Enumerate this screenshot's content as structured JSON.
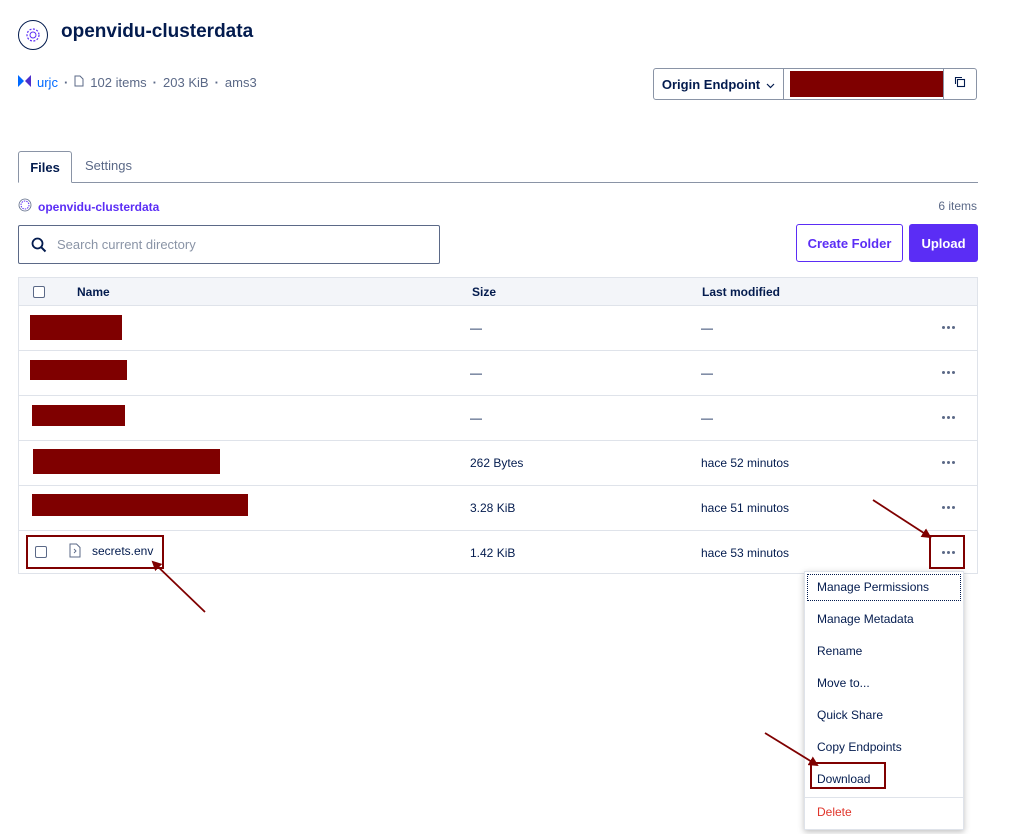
{
  "header": {
    "title": "openvidu-clusterdata",
    "project": "urjc",
    "item_count": "102 items",
    "size": "203 KiB",
    "region": "ams3",
    "endpoint_label": "Origin Endpoint"
  },
  "tabs": [
    {
      "label": "Files",
      "active": true
    },
    {
      "label": "Settings",
      "active": false
    }
  ],
  "breadcrumb": "openvidu-clusterdata",
  "items_count": "6 items",
  "search": {
    "placeholder": "Search current directory"
  },
  "buttons": {
    "create_folder": "Create Folder",
    "upload": "Upload"
  },
  "table": {
    "columns": [
      "Name",
      "Size",
      "Last modified"
    ],
    "rows": [
      {
        "name": "",
        "size": "—",
        "modified": "—"
      },
      {
        "name": "",
        "size": "—",
        "modified": "—"
      },
      {
        "name": "",
        "size": "—",
        "modified": "—"
      },
      {
        "name": "",
        "size": "262 Bytes",
        "modified": "hace 52 minutos"
      },
      {
        "name": "",
        "size": "3.28 KiB",
        "modified": "hace 51 minutos"
      },
      {
        "name": "secrets.env",
        "size": "1.42 KiB",
        "modified": "hace 53 minutos"
      }
    ]
  },
  "menu": {
    "items": [
      "Manage Permissions",
      "Manage Metadata",
      "Rename",
      "Move to...",
      "Quick Share",
      "Copy Endpoints",
      "Download"
    ],
    "delete": "Delete"
  },
  "colors": {
    "accent": "#5b2df5",
    "annotation": "#7f0000",
    "danger": "#e0352b",
    "text": "#031b4e"
  }
}
